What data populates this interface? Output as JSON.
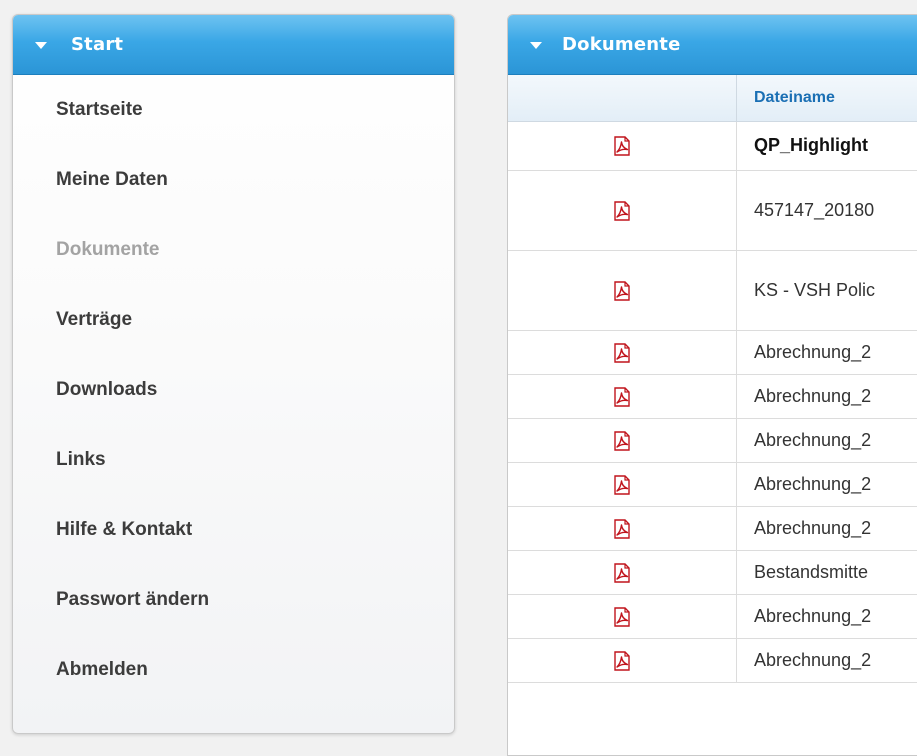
{
  "left_panel": {
    "title": "Start",
    "items": [
      {
        "label": "Startseite",
        "disabled": false
      },
      {
        "label": "Meine Daten",
        "disabled": false
      },
      {
        "label": "Dokumente",
        "disabled": true
      },
      {
        "label": "Verträge",
        "disabled": false
      },
      {
        "label": "Downloads",
        "disabled": false
      },
      {
        "label": "Links",
        "disabled": false
      },
      {
        "label": "Hilfe & Kontakt",
        "disabled": false
      },
      {
        "label": "Passwort ändern",
        "disabled": false
      },
      {
        "label": "Abmelden",
        "disabled": false
      }
    ]
  },
  "right_panel": {
    "title": "Dokumente",
    "columns": [
      "",
      "Dateiname"
    ],
    "rows": [
      {
        "icon": "pdf-icon",
        "name": "QP_Highlight",
        "bold": true
      },
      {
        "icon": "pdf-icon",
        "name": "457147_20180",
        "bold": false
      },
      {
        "icon": "pdf-icon",
        "name": "KS - VSH Polic",
        "bold": false
      },
      {
        "icon": "pdf-icon",
        "name": "Abrechnung_2",
        "bold": false
      },
      {
        "icon": "pdf-icon",
        "name": "Abrechnung_2",
        "bold": false
      },
      {
        "icon": "pdf-icon",
        "name": "Abrechnung_2",
        "bold": false
      },
      {
        "icon": "pdf-icon",
        "name": "Abrechnung_2",
        "bold": false
      },
      {
        "icon": "pdf-icon",
        "name": "Abrechnung_2",
        "bold": false
      },
      {
        "icon": "pdf-icon",
        "name": "Bestandsmitte",
        "bold": false
      },
      {
        "icon": "pdf-icon",
        "name": "Abrechnung_2",
        "bold": false
      },
      {
        "icon": "pdf-icon",
        "name": "Abrechnung_2",
        "bold": false
      }
    ]
  },
  "colors": {
    "header_blue": "#3aa7e6",
    "column_header_text": "#1a6fb4",
    "pdf_red": "#c0141c"
  }
}
